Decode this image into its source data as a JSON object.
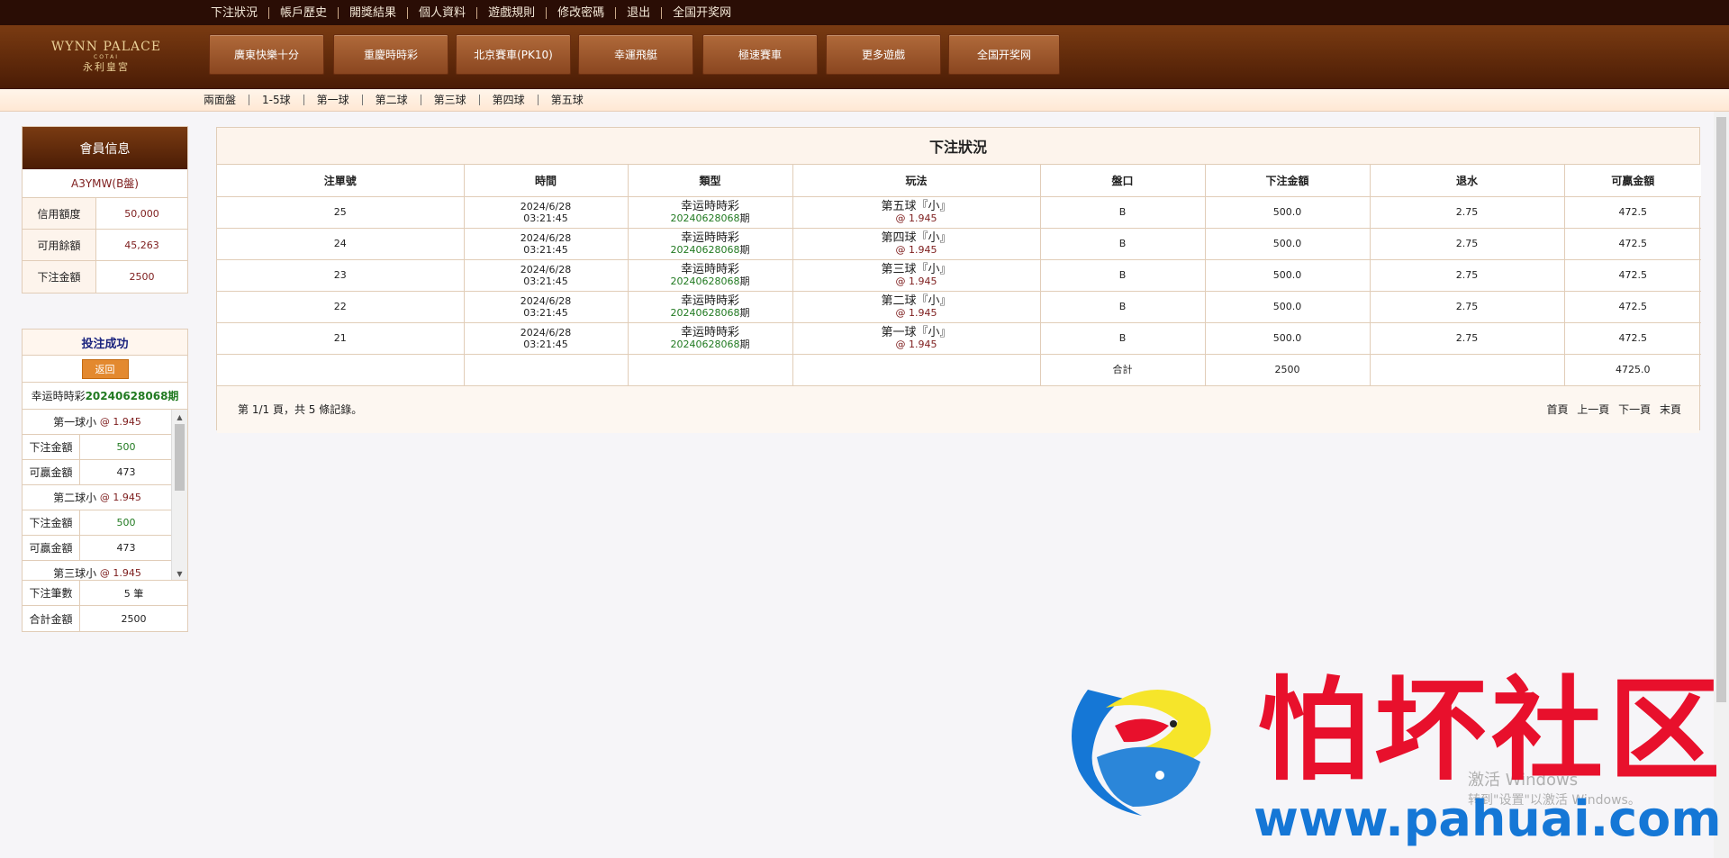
{
  "topnav": [
    "下注狀況",
    "帳戶歷史",
    "開獎結果",
    "個人資料",
    "遊戲規則",
    "修改密碼",
    "退出",
    "全国开奖网"
  ],
  "logo": {
    "line1": "WYNN PALACE",
    "line2": "COTAI",
    "line3": "永利皇宮"
  },
  "games": [
    "廣東快樂十分",
    "重慶時時彩",
    "北京賽車(PK10)",
    "幸運飛艇",
    "極速賽車",
    "更多遊戲",
    "全国开奖网"
  ],
  "subnav": [
    "兩面盤",
    "1-5球",
    "第一球",
    "第二球",
    "第三球",
    "第四球",
    "第五球"
  ],
  "member": {
    "title": "會員信息",
    "account": "A3YMW(B盤)",
    "rows": [
      {
        "k": "信用額度",
        "v": "50,000"
      },
      {
        "k": "可用餘額",
        "v": "45,263"
      },
      {
        "k": "下注金額",
        "v": "2500"
      }
    ]
  },
  "result": {
    "title": "投注成功",
    "back": "返回",
    "game": "幸运時時彩",
    "issue": "20240628068期",
    "items": [
      {
        "title": "第一球小",
        "odds": "@ 1.945",
        "amount_label": "下注金額",
        "amount": "500",
        "win_label": "可贏金額",
        "win": "473"
      },
      {
        "title": "第二球小",
        "odds": "@ 1.945",
        "amount_label": "下注金額",
        "amount": "500",
        "win_label": "可贏金額",
        "win": "473"
      },
      {
        "title": "第三球小",
        "odds": "@ 1.945"
      }
    ],
    "count_label": "下注筆數",
    "count": "5 筆",
    "total_label": "合計金額",
    "total": "2500"
  },
  "main": {
    "title": "下注狀況",
    "headers": [
      "注單號",
      "時間",
      "類型",
      "玩法",
      "盤口",
      "下注金額",
      "退水",
      "可贏金額"
    ],
    "rows": [
      {
        "id": "25",
        "date": "2024/6/28",
        "time": "03:21:45",
        "game": "幸运時時彩",
        "issue_num": "20240628068",
        "issue_suffix": "期",
        "play": "第五球『小』",
        "odds": "@ 1.945",
        "pan": "B",
        "amount": "500.0",
        "rebate": "2.75",
        "win": "472.5"
      },
      {
        "id": "24",
        "date": "2024/6/28",
        "time": "03:21:45",
        "game": "幸运時時彩",
        "issue_num": "20240628068",
        "issue_suffix": "期",
        "play": "第四球『小』",
        "odds": "@ 1.945",
        "pan": "B",
        "amount": "500.0",
        "rebate": "2.75",
        "win": "472.5"
      },
      {
        "id": "23",
        "date": "2024/6/28",
        "time": "03:21:45",
        "game": "幸运時時彩",
        "issue_num": "20240628068",
        "issue_suffix": "期",
        "play": "第三球『小』",
        "odds": "@ 1.945",
        "pan": "B",
        "amount": "500.0",
        "rebate": "2.75",
        "win": "472.5"
      },
      {
        "id": "22",
        "date": "2024/6/28",
        "time": "03:21:45",
        "game": "幸运時時彩",
        "issue_num": "20240628068",
        "issue_suffix": "期",
        "play": "第二球『小』",
        "odds": "@ 1.945",
        "pan": "B",
        "amount": "500.0",
        "rebate": "2.75",
        "win": "472.5"
      },
      {
        "id": "21",
        "date": "2024/6/28",
        "time": "03:21:45",
        "game": "幸运時時彩",
        "issue_num": "20240628068",
        "issue_suffix": "期",
        "play": "第一球『小』",
        "odds": "@ 1.945",
        "pan": "B",
        "amount": "500.0",
        "rebate": "2.75",
        "win": "472.5"
      }
    ],
    "total_label": "合計",
    "total_amount": "2500",
    "total_win": "4725.0",
    "pager_info": "第 1/1 頁，共 5 條記錄。",
    "pager_links": [
      "首頁",
      "上一頁",
      "下一頁",
      "末頁"
    ]
  },
  "watermark": {
    "text": "怕坏社区",
    "url": "www.pahuai.com"
  },
  "activate": {
    "line1": "激活 Windows",
    "line2": "转到\"设置\"以激活 Windows。"
  },
  "colors": {
    "brown": "#4b1c05",
    "accent": "#7d1c1c",
    "green": "#217a21",
    "watermark_red": "#e8102c",
    "watermark_blue": "#1577d6"
  }
}
